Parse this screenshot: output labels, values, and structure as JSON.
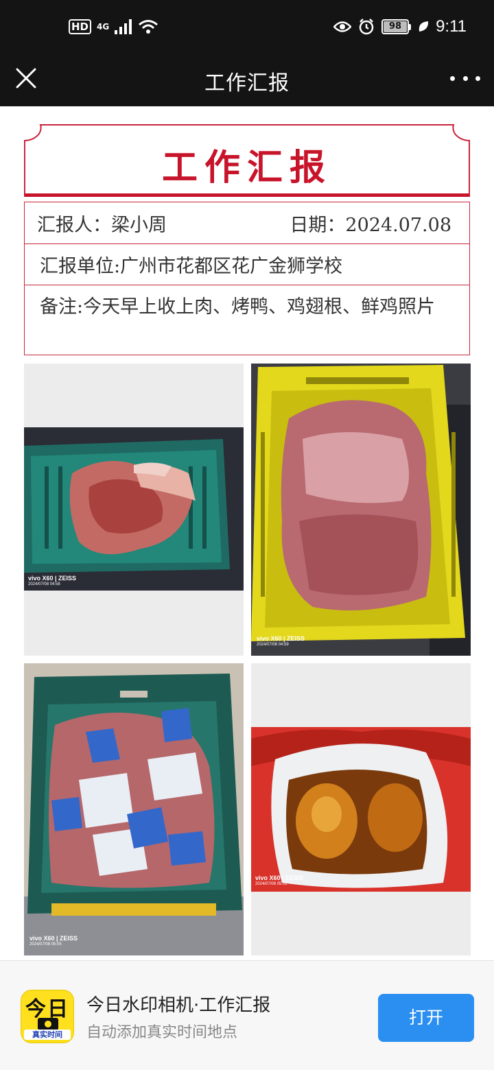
{
  "status_bar": {
    "hd": "HD",
    "network": "4G",
    "battery": "98",
    "time": "9:11"
  },
  "title_bar": {
    "title": "工作汇报"
  },
  "report": {
    "title": "工作汇报",
    "reporter": "汇报人：梁小周",
    "date": "日期：2024.07.08",
    "unit": "汇报单位:广州市花都区花广金狮学校",
    "note": "备注:今天早上收上肉、烤鸭、鸡翅根、鲜鸡照片"
  },
  "photos": [
    {
      "brand": "vivo X60 | ZEISS",
      "date": "2024/07/08 04:58"
    },
    {
      "brand": "vivo X60 | ZEISS",
      "date": "2024/07/08 04:59"
    },
    {
      "brand": "vivo X60 | ZEISS",
      "date": "2024/07/08 05:05"
    },
    {
      "brand": "vivo X60 | ZEISS",
      "date": "2024/07/08 05:02"
    }
  ],
  "banner": {
    "icon_big": "今日",
    "icon_small": "真实时间",
    "app_name": "今日水印相机·工作汇报",
    "app_desc": "自动添加真实时间地点",
    "open_label": "打开"
  },
  "colors": {
    "accent_red": "#c8142b",
    "open_button": "#2a8ff0",
    "icon_yellow": "#ffe01e"
  }
}
